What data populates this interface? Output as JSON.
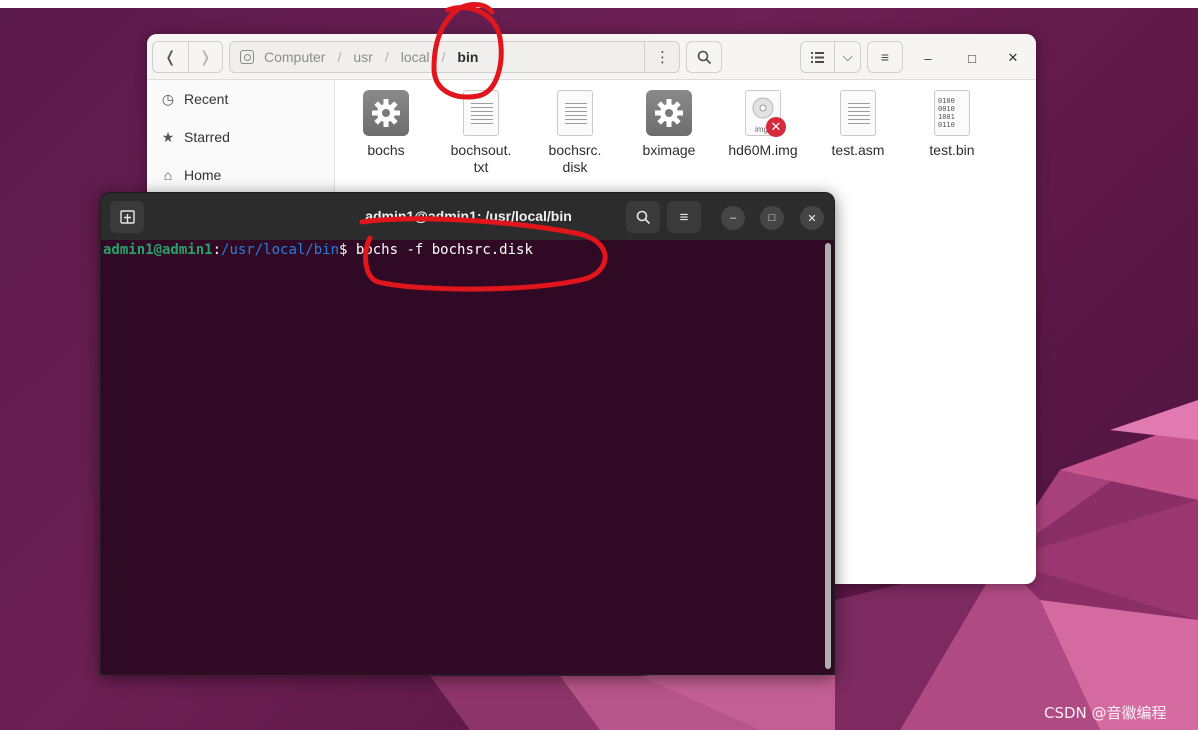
{
  "files_window": {
    "path": [
      "Computer",
      "usr",
      "local",
      "bin"
    ],
    "sidebar": [
      {
        "label": "Recent",
        "icon": "clock-icon"
      },
      {
        "label": "Starred",
        "icon": "star-icon"
      },
      {
        "label": "Home",
        "icon": "home-icon"
      }
    ],
    "files": [
      {
        "name_line1": "bochs",
        "name_line2": "",
        "icon": "executable-gear-icon"
      },
      {
        "name_line1": "bochsout.",
        "name_line2": "txt",
        "icon": "text-file-icon"
      },
      {
        "name_line1": "bochsrc.",
        "name_line2": "disk",
        "icon": "text-file-icon"
      },
      {
        "name_line1": "bximage",
        "name_line2": "",
        "icon": "executable-gear-icon"
      },
      {
        "name_line1": "hd60M.img",
        "name_line2": "",
        "icon": "disk-image-icon"
      },
      {
        "name_line1": "test.asm",
        "name_line2": "",
        "icon": "text-file-icon"
      },
      {
        "name_line1": "test.bin",
        "name_line2": "",
        "icon": "binary-file-icon"
      }
    ],
    "binary_icon_text": "0100\n0010\n1001\n0110",
    "disk_image_badge": "img"
  },
  "terminal": {
    "title": "admin1@admin1: /usr/local/bin",
    "prompt_user": "admin1@admin1",
    "prompt_colon": ":",
    "prompt_path": "/usr/local/bin",
    "prompt_dollar": "$",
    "command": " bochs -f bochsrc.disk"
  },
  "watermark": "CSDN @音徽编程",
  "colors": {
    "terminal_bg": "#300a24",
    "prompt_user": "#26a269",
    "prompt_path": "#2a7bde",
    "annotation": "#e0161c"
  }
}
